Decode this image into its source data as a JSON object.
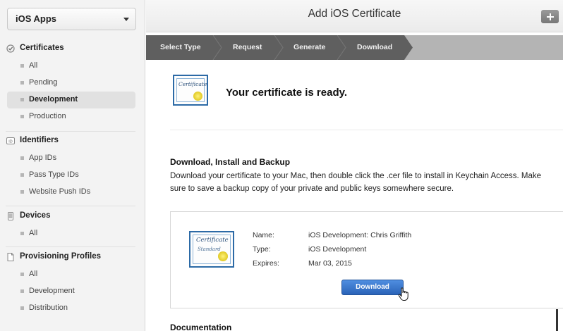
{
  "sidebar": {
    "app_select": "iOS Apps",
    "sections": [
      {
        "title": "Certificates",
        "items": [
          "All",
          "Pending",
          "Development",
          "Production"
        ],
        "active": "Development"
      },
      {
        "title": "Identifiers",
        "items": [
          "App IDs",
          "Pass Type IDs",
          "Website Push IDs"
        ]
      },
      {
        "title": "Devices",
        "items": [
          "All"
        ]
      },
      {
        "title": "Provisioning Profiles",
        "items": [
          "All",
          "Development",
          "Distribution"
        ]
      }
    ]
  },
  "header": {
    "title": "Add iOS Certificate"
  },
  "steps": [
    "Select Type",
    "Request",
    "Generate",
    "Download"
  ],
  "main": {
    "ready_text": "Your certificate is ready.",
    "cert_icon_text": "Certificate",
    "cert_icon_sub": "Standard",
    "download_heading": "Download, Install and Backup",
    "download_desc": "Download your certificate to your Mac, then double click the .cer file to install in Keychain Access. Make sure to save a backup copy of your private and public keys somewhere secure.",
    "card": {
      "name_label": "Name:",
      "name_value": "iOS Development: Chris Griffith",
      "type_label": "Type:",
      "type_value": "iOS Development",
      "expires_label": "Expires:",
      "expires_value": "Mar 03, 2015",
      "download_button": "Download"
    },
    "documentation_heading": "Documentation"
  },
  "colors": {
    "accent": "#2a63b8",
    "steps_active": "#5f5f5f",
    "steps_inactive": "#b4b4b4"
  }
}
